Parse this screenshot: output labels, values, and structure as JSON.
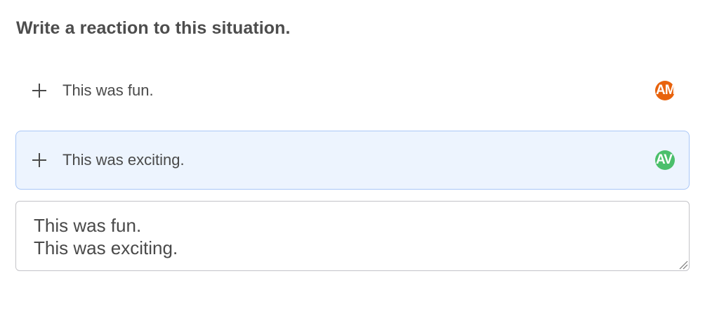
{
  "prompt": {
    "title": "Write a reaction to this situation."
  },
  "suggestions": [
    {
      "text": "This was fun.",
      "icon": "plus-icon",
      "avatar": {
        "initials": "AM",
        "color": "#e8620c"
      }
    },
    {
      "text": "This was exciting.",
      "icon": "plus-icon",
      "avatar": {
        "initials": "AV",
        "color": "#4bbf6b"
      }
    }
  ],
  "response": {
    "value": "This was fun.\nThis was exciting."
  }
}
